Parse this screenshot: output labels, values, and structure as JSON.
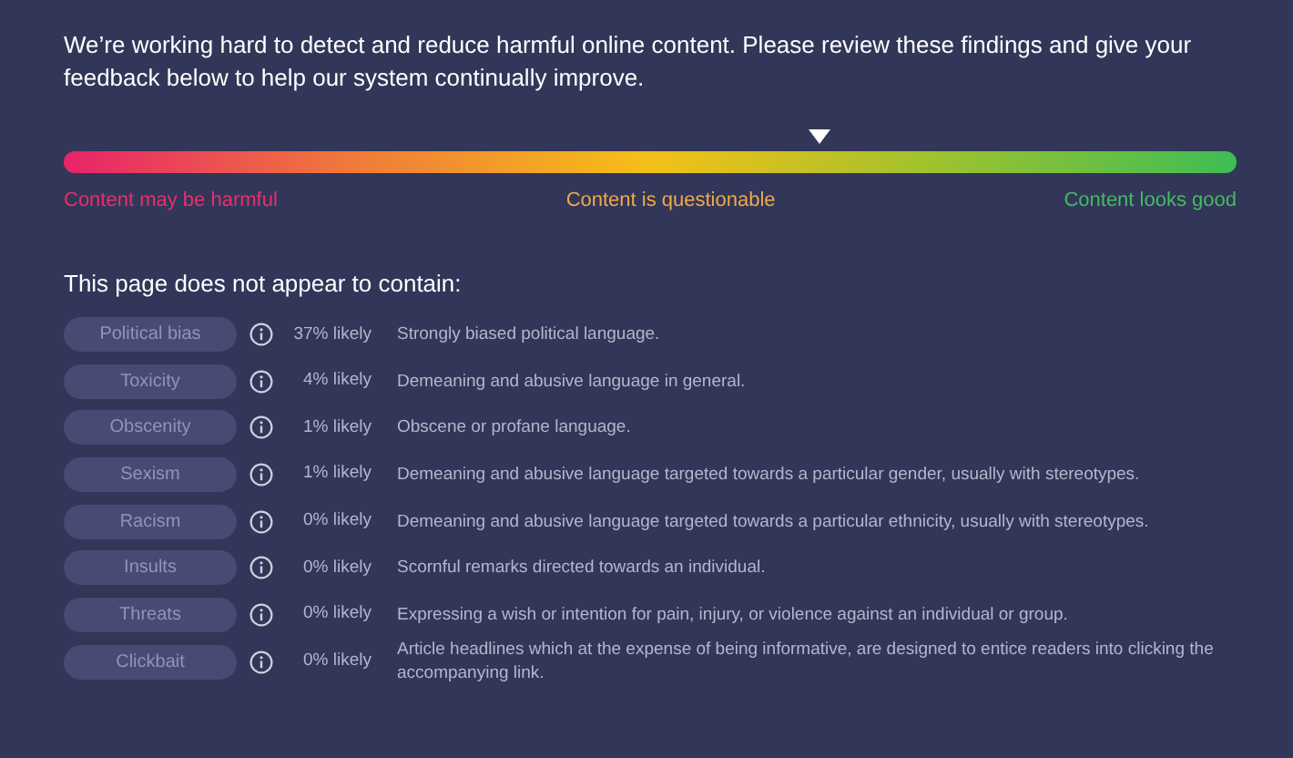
{
  "intro": "We’re working hard to detect and reduce harmful online content. Please review these findings and give your feedback below to help our system continually improve.",
  "meter": {
    "labels": [
      "Content may be harmful",
      "Content is questionable",
      "Content looks good"
    ]
  },
  "heading": "This page does not appear to contain:",
  "findings": [
    {
      "label": "Political bias",
      "likelihood": "37% likely",
      "description": "Strongly biased political language."
    },
    {
      "label": "Toxicity",
      "likelihood": "4% likely",
      "description": "Demeaning and abusive language in general."
    },
    {
      "label": "Obscenity",
      "likelihood": "1% likely",
      "description": "Obscene or profane language."
    },
    {
      "label": "Sexism",
      "likelihood": "1% likely",
      "description": "Demeaning and abusive language targeted towards a particular gender, usually with stereotypes."
    },
    {
      "label": "Racism",
      "likelihood": "0% likely",
      "description": "Demeaning and abusive language targeted towards a particular ethnicity, usually with stereotypes."
    },
    {
      "label": "Insults",
      "likelihood": "0% likely",
      "description": "Scornful remarks directed towards an individual."
    },
    {
      "label": "Threats",
      "likelihood": "0% likely",
      "description": "Expressing a wish or intention for pain, injury, or violence against an individual or group."
    },
    {
      "label": "Clickbait",
      "likelihood": "0% likely",
      "description": "Article headlines which at the expense of being informative, are designed to entice readers into clicking the accompanying link."
    }
  ]
}
